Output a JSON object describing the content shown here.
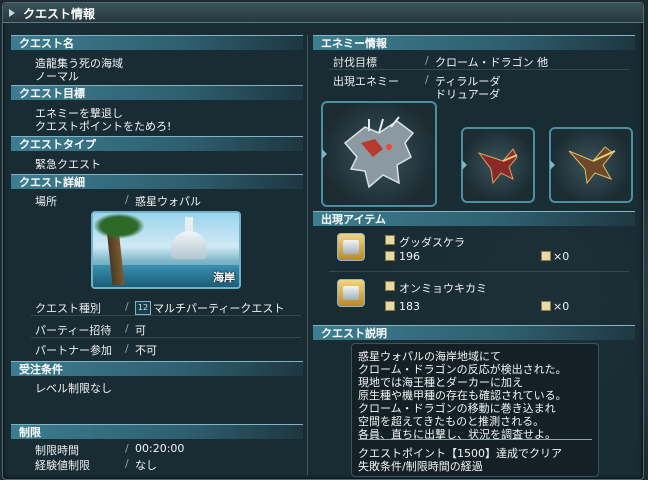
{
  "window": {
    "title": "クエスト情報"
  },
  "left": {
    "sections": {
      "quest_name": "クエスト名",
      "quest_goal": "クエスト目標",
      "quest_type": "クエストタイプ",
      "quest_detail": "クエスト詳細",
      "accept": "受注条件",
      "limit": "制限"
    },
    "quest_name_lines": [
      "造龍集う死の海域",
      "ノーマル"
    ],
    "quest_goal_lines": [
      "エネミーを撃退し",
      "クエストポイントをためろ!"
    ],
    "quest_type_value": "緊急クエスト",
    "detail": {
      "place_label": "場所",
      "place_value": "惑星ウォパル",
      "thumb_caption": "海岸",
      "kind_label": "クエスト種別",
      "kind_badge": "12",
      "kind_value": "マルチパーティークエスト",
      "party_label": "パーティー招待",
      "party_value": "可",
      "partner_label": "パートナー参加",
      "partner_value": "不可"
    },
    "accept_value": "レベル制限なし",
    "limit": {
      "time_label": "制限時間",
      "time_value": "00:20:00",
      "exp_label": "経験値制限",
      "exp_value": "なし"
    }
  },
  "right": {
    "sections": {
      "enemy_info": "エネミー情報",
      "items": "出現アイテム",
      "quest_desc": "クエスト説明"
    },
    "target_label": "討伐目標",
    "target_value": "クローム・ドラゴン 他",
    "enemies_label": "出現エネミー",
    "enemies_lines": [
      "ティラルーダ",
      "ドリュアーダ"
    ],
    "items": [
      {
        "name": "グッダスケラ",
        "count": "196",
        "qty": "×0"
      },
      {
        "name": "オンミョウキカミ",
        "count": "183",
        "qty": "×0"
      }
    ],
    "desc_lines": [
      "惑星ウォパルの海岸地域にて",
      "クローム・ドラゴンの反応が検出された。",
      "現地では海王種とダーカーに加え",
      "原生種や機甲種の存在も確認されている。",
      "クローム・ドラゴンの移動に巻き込まれ",
      "空間を超えてきたものと推測される。",
      "各員、直ちに出撃し、状況を調査せよ。"
    ],
    "desc_footer_lines": [
      "クエストポイント【1500】達成でクリア",
      "失敗条件/制限時間の経過"
    ]
  },
  "colors": {
    "accent": "#3d7d90",
    "panel": "#1a2c34",
    "border": "#6fb3c8"
  },
  "icons": [
    "dragon-enemy-icon",
    "bird-enemy-icon",
    "item-icon"
  ]
}
